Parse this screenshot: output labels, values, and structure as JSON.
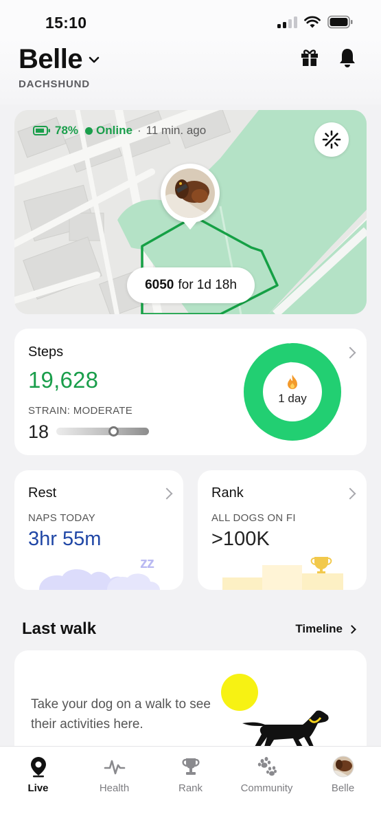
{
  "status_bar": {
    "time": "15:10"
  },
  "header": {
    "dog_name": "Belle",
    "breed": "DACHSHUND",
    "icons": [
      "gift-icon",
      "bell-icon"
    ]
  },
  "map": {
    "battery": "78%",
    "online": "Online",
    "separator": "·",
    "last_seen": "11 min. ago",
    "pill_value": "6050",
    "pill_text": "for 1d 18h",
    "colors": {
      "park": "#b4e2c6",
      "zone": "#15a045"
    }
  },
  "steps": {
    "title": "Steps",
    "value": "19,628",
    "strain_label": "STRAIN: MODERATE",
    "strain_value": "18",
    "streak": "1 day",
    "ring_progress": 0.98,
    "colors": {
      "accent": "#1a9e4b",
      "ring": "#22cf72"
    }
  },
  "rest": {
    "title": "Rest",
    "caption": "NAPS TODAY",
    "value": "3hr 55m",
    "zz": "zz"
  },
  "rank": {
    "title": "Rank",
    "caption": "ALL DOGS ON FI",
    "value": ">100K"
  },
  "last_walk": {
    "title": "Last walk",
    "timeline_label": "Timeline",
    "empty_text": "Take your dog on a walk to see their activities here."
  },
  "tabs": [
    {
      "label": "Live",
      "icon": "location-pin-icon",
      "active": true
    },
    {
      "label": "Health",
      "icon": "pulse-icon",
      "active": false
    },
    {
      "label": "Rank",
      "icon": "trophy-icon",
      "active": false
    },
    {
      "label": "Community",
      "icon": "paw-icon",
      "active": false
    },
    {
      "label": "Belle",
      "icon": "dog-avatar-icon",
      "active": false
    }
  ]
}
